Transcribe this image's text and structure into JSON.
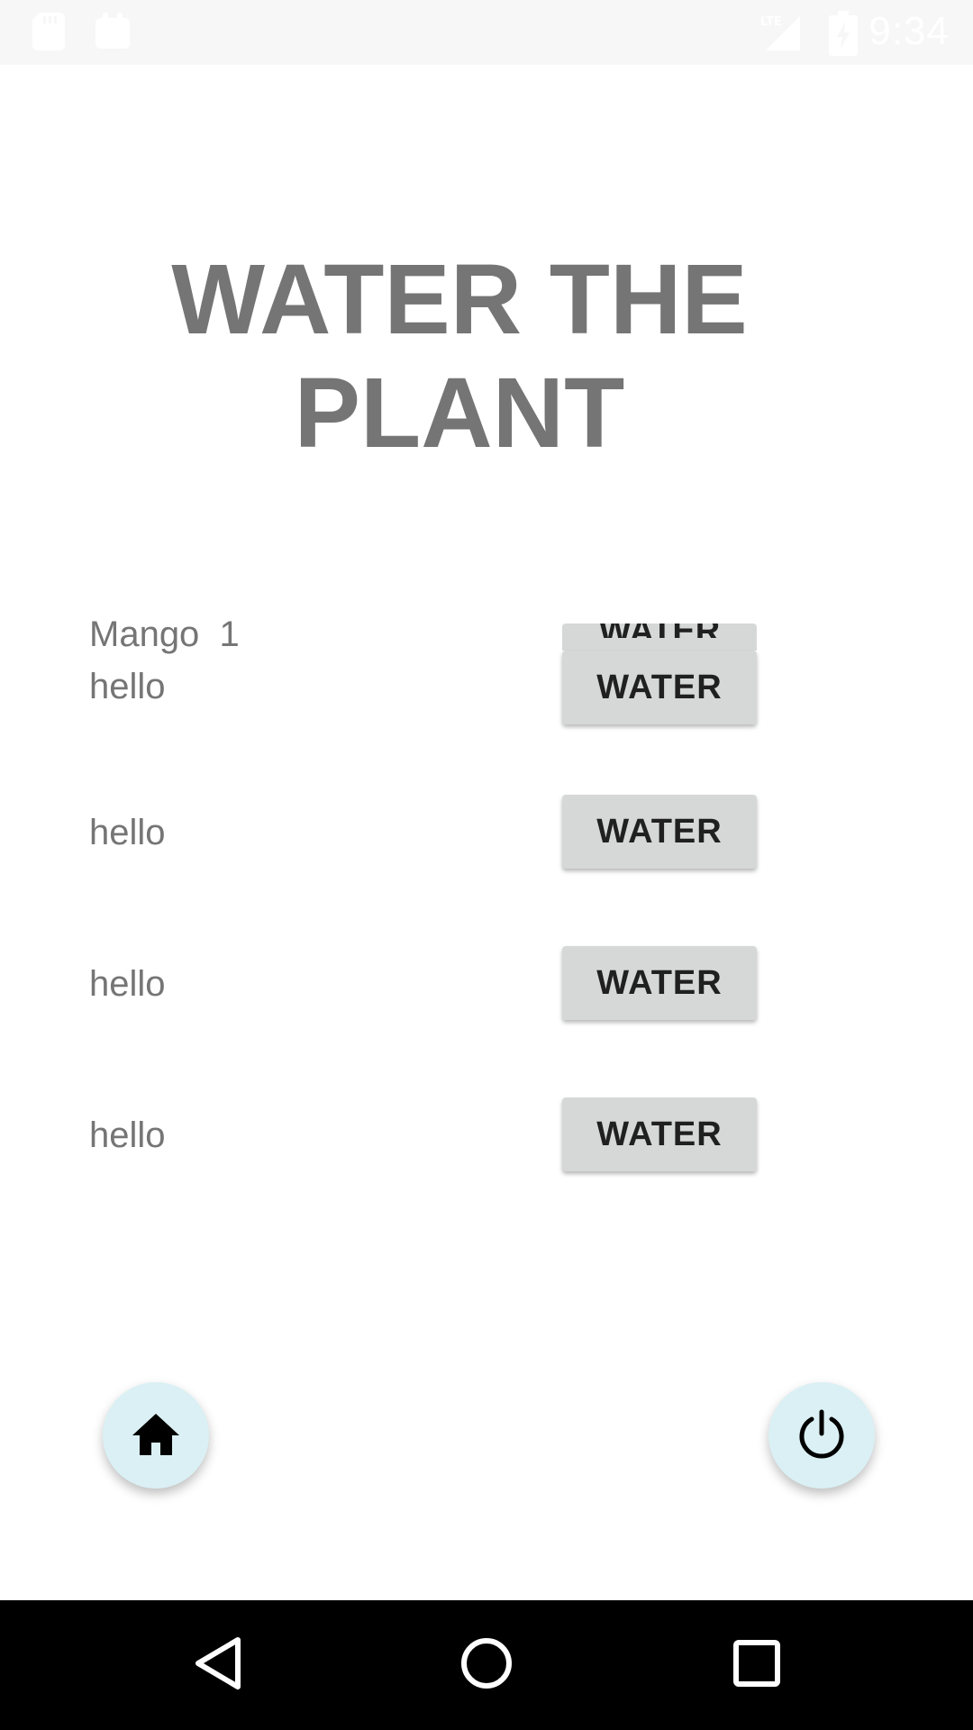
{
  "status_bar": {
    "time": "9:34",
    "icons": [
      "sd-card-icon",
      "notification-icon",
      "lte-signal-icon",
      "battery-charging-icon"
    ],
    "background": "#f7f7f7"
  },
  "title": "WATER THE PLANT",
  "plants": [
    {
      "name": "Mango  1",
      "text": "hello",
      "button_label": "WATER"
    },
    {
      "text": "hello",
      "button_label": "WATER"
    },
    {
      "text": "hello",
      "button_label": "WATER"
    },
    {
      "text": "hello",
      "button_label": "WATER"
    }
  ],
  "fabs": {
    "home_icon": "home-icon",
    "power_icon": "power-icon",
    "background": "#daf0f4"
  },
  "nav_bar": {
    "buttons": [
      "back-icon",
      "home-circle-icon",
      "recents-icon"
    ]
  },
  "colors": {
    "title": "#757575",
    "label": "#757575",
    "button_bg": "#d6d7d7",
    "button_text": "#202020"
  }
}
